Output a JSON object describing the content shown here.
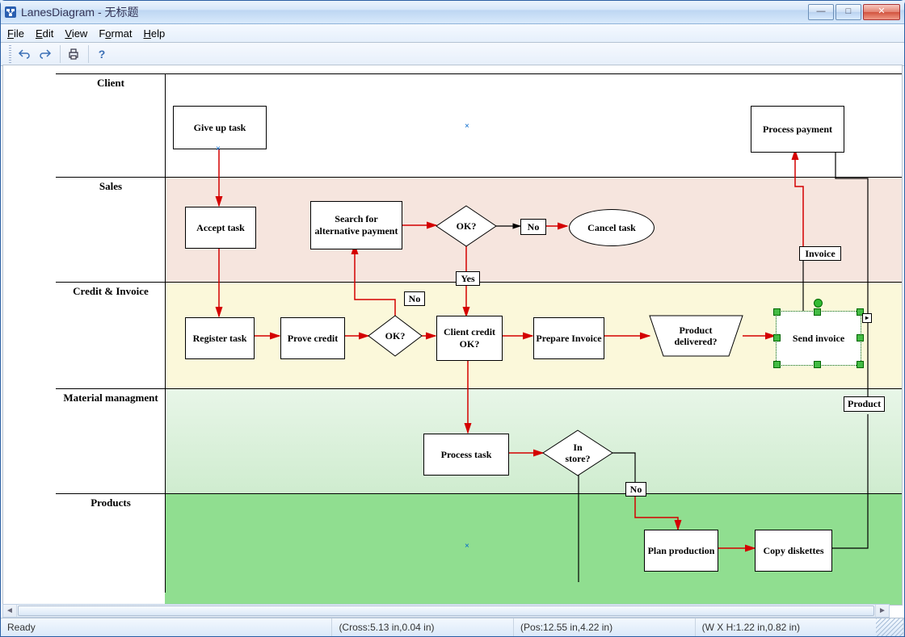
{
  "window": {
    "title_app": "LanesDiagram",
    "title_doc": "无标题"
  },
  "menu": {
    "file": "File",
    "edit": "Edit",
    "view": "View",
    "format": "Format",
    "help": "Help"
  },
  "status": {
    "ready": "Ready",
    "cross": "(Cross:5.13 in,0.04 in)",
    "pos": "(Pos:12.55 in,4.22 in)",
    "size": "(W X H:1.22 in,0.82 in)"
  },
  "lanes": {
    "client": "Client",
    "sales": "Sales",
    "credit": "Credit & Invoice",
    "material": "Material managment",
    "products": "Products"
  },
  "nodes": {
    "give_up": "Give up task",
    "process_payment": "Process payment",
    "accept_task": "Accept task",
    "search_alt": "Search for alternative payment",
    "ok1": "OK?",
    "cancel_task": "Cancel task",
    "register": "Register task",
    "prove_credit": "Prove credit",
    "ok2": "OK?",
    "client_credit": "Client credit OK?",
    "prepare_invoice": "Prepare Invoice",
    "product_delivered": "Product delivered?",
    "send_invoice": "Send invoice",
    "process_task": "Process task",
    "in_store": "In store?",
    "plan_production": "Plan production",
    "copy_diskettes": "Copy diskettes"
  },
  "edge_labels": {
    "no1": "No",
    "yes": "Yes",
    "no2": "No",
    "no3": "No",
    "invoice": "Invoice",
    "product": "Product"
  },
  "colors": {
    "lane_sales": "#f6e5de",
    "lane_credit": "#fbf8da",
    "lane_material_top": "#e8f6e8",
    "lane_material_bot": "#cfeccf",
    "lane_products": "#90de90",
    "arrow_red": "#d40000",
    "arrow_black": "#000000"
  }
}
